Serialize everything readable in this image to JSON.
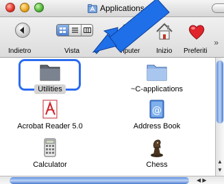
{
  "window": {
    "title": "Applications"
  },
  "toolbar": {
    "back_label": "Indietro",
    "view_label": "Vista",
    "computer_label": "nputer",
    "home_label": "Inizio",
    "favorites_label": "Preferiti"
  },
  "items": [
    {
      "label": "Utilities",
      "icon": "folder-icon",
      "selected": true
    },
    {
      "label": "~C-applications",
      "icon": "folder-icon"
    },
    {
      "label": "Acrobat Reader 5.0",
      "icon": "acrobat-icon"
    },
    {
      "label": "Address Book",
      "icon": "address-book-icon"
    },
    {
      "label": "Calculator",
      "icon": "calculator-icon"
    },
    {
      "label": "Chess",
      "icon": "chess-icon"
    }
  ],
  "colors": {
    "highlight": "#2a6bf0",
    "arrow": "#1f6fe8",
    "selection_bg": "#d4d4d4"
  }
}
